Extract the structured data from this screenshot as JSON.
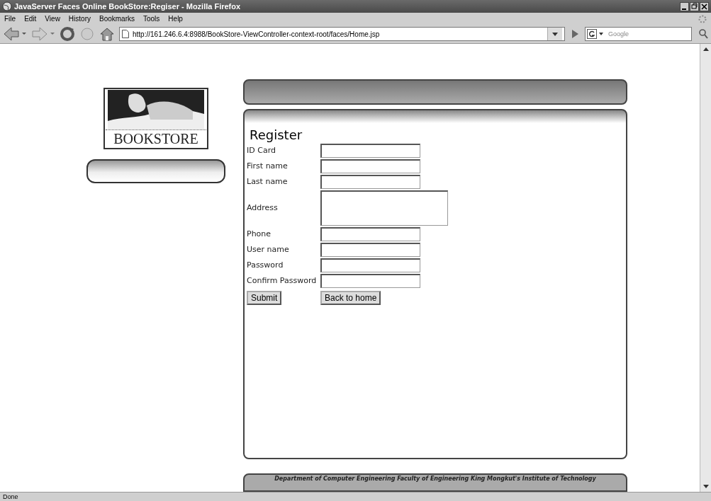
{
  "window": {
    "title": "JavaServer Faces Online BookStore:Regiser - Mozilla Firefox"
  },
  "menu": [
    "File",
    "Edit",
    "View",
    "History",
    "Bookmarks",
    "Tools",
    "Help"
  ],
  "toolbar": {
    "url": "http://161.246.6.4:8988/BookStore-ViewController-context-root/faces/Home.jsp",
    "search_placeholder": "Google"
  },
  "page": {
    "logo_text": "BOOKSTORE",
    "form": {
      "title": "Register",
      "fields": [
        {
          "label": "ID Card",
          "kind": "text"
        },
        {
          "label": "First name",
          "kind": "text"
        },
        {
          "label": "Last name",
          "kind": "text"
        },
        {
          "label": "Address",
          "kind": "textarea"
        },
        {
          "label": "Phone",
          "kind": "text"
        },
        {
          "label": "User name",
          "kind": "text"
        },
        {
          "label": "Password",
          "kind": "text"
        },
        {
          "label": "Confirm Password",
          "kind": "text"
        }
      ],
      "buttons": [
        "Submit",
        "Back to home"
      ]
    },
    "footer": "Department of Computer Engineering Faculty of Engineering King Mongkut's Institute of Technology"
  },
  "status_bar": "Done"
}
